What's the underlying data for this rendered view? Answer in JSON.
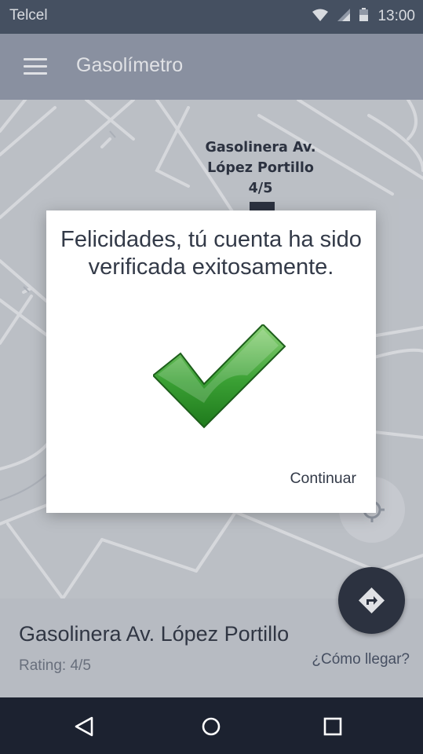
{
  "status_bar": {
    "carrier": "Telcel",
    "time": "13:00",
    "icons": [
      "wifi-icon",
      "signal-icon",
      "battery-icon"
    ]
  },
  "app_bar": {
    "title": "Gasolímetro",
    "menu_icon": "hamburger-menu-icon"
  },
  "map": {
    "marker": {
      "name_line1": "Gasolinera Av.",
      "name_line2": "López Portillo",
      "rating": "4/5"
    },
    "locate_icon": "crosshair-icon"
  },
  "bottom_panel": {
    "station_name": "Gasolinera Av. López Portillo",
    "rating_text": "Rating: 4/5",
    "route_link": "¿Cómo llegar?",
    "fab_icon": "directions-icon"
  },
  "dialog": {
    "title": "Felicidades, tú cuenta ha sido verificada exitosamente.",
    "icon": "checkmark-icon",
    "continue_label": "Continuar"
  },
  "nav_bar": {
    "icons": [
      "back-icon",
      "home-icon",
      "recents-icon"
    ]
  },
  "colors": {
    "status_bar": "#4a5568",
    "app_bar": "#929aaa",
    "map": "#c7cbd2",
    "dark": "#2f3645",
    "nav_bar": "#1c2230",
    "check_green": "#3aa034"
  }
}
